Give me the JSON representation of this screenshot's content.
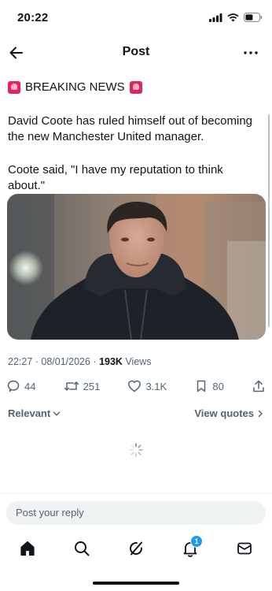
{
  "status_bar": {
    "time": "20:22"
  },
  "nav": {
    "title": "Post"
  },
  "post": {
    "headline": "BREAKING NEWS",
    "paragraph1": "David Coote has ruled himself out of becoming the new Manchester United manager.",
    "paragraph2": "Coote said, \"I have my reputation to think about.\"",
    "time": "22:27",
    "date": "08/01/2026",
    "views_count": "193K",
    "views_label": "Views",
    "stats": {
      "replies": "44",
      "reposts": "251",
      "likes": "3.1K",
      "bookmarks": "80"
    }
  },
  "replies": {
    "sort_label": "Relevant",
    "quotes_link": "View quotes"
  },
  "composer": {
    "placeholder": "Post your reply"
  },
  "tabbar": {
    "notification_badge": "1"
  },
  "colors": {
    "accent": "#1d9bf0",
    "muted": "#536471",
    "text": "#0f1419",
    "alert": "#e0245e"
  }
}
